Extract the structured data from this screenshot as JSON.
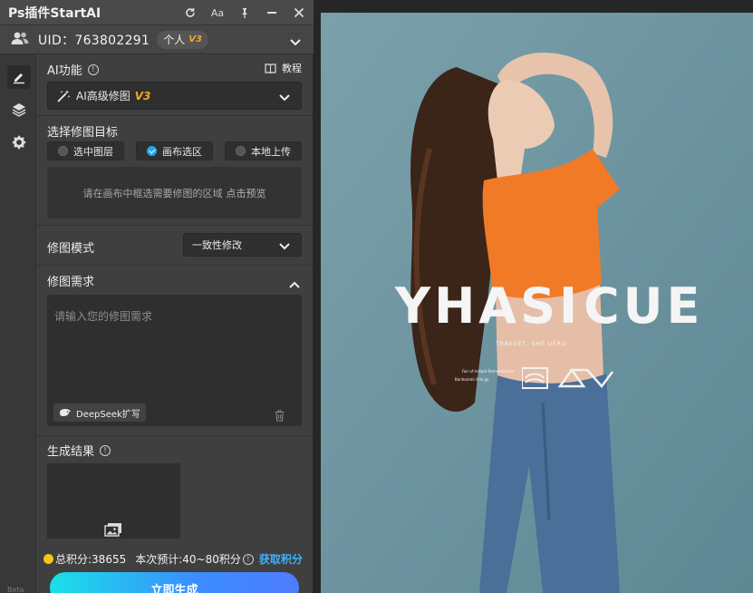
{
  "app": {
    "title": "Ps插件StartAI"
  },
  "titlebar": {
    "font_btn": "Aa"
  },
  "user": {
    "uid": "UID：763802291",
    "plan": "个人",
    "plan_version": "V3"
  },
  "ai_function": {
    "label": "AI功能",
    "tutorial": "教程",
    "selected": "AI高级修图",
    "selected_version": "V3"
  },
  "target": {
    "label": "选择修图目标",
    "options": [
      "选中图层",
      "画布选区",
      "本地上传"
    ],
    "hint": "请在画布中框选需要修图的区域",
    "hint_link": "点击预览"
  },
  "mode": {
    "label": "修图模式",
    "value": "一致性修改"
  },
  "request": {
    "label": "修图需求",
    "placeholder": "请输入您的修图需求",
    "deepseek": "DeepSeek扩写"
  },
  "result": {
    "label": "生成结果"
  },
  "footer": {
    "total_points": "总积分:38655",
    "estimate": "本次预计:40~80积分",
    "earn": "获取积分",
    "generate": "立即生成",
    "rail_note": "Beta"
  },
  "poster": {
    "headline_left": "YHASI",
    "headline_right": "CUE",
    "sub": "TRASSET, SHE UERO",
    "small_1": "Fair of Instant Remembrance",
    "small_2": "Banhommi Orlo ge"
  },
  "colors": {
    "accent": "#23a6f5",
    "gradient_start": "#19e0e8",
    "gradient_end": "#4f7cff",
    "version": "#f5a623",
    "photo_bg": "#6e95a1",
    "shirt": "#f07a26",
    "jeans": "#4a6f99"
  }
}
